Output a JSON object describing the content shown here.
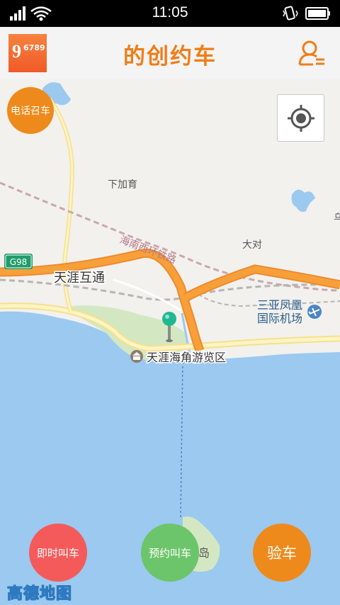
{
  "status": {
    "time": "11:05"
  },
  "header": {
    "title": "的创约车",
    "logo_main": "9",
    "logo_num": "6789"
  },
  "buttons": {
    "phone_call": "电话召车",
    "now_call": "即时叫车",
    "book_call": "预约叫车",
    "check_car": "验车"
  },
  "map": {
    "labels": {
      "xiajiayu": "下加育",
      "dadui": "大对",
      "railway": "海南西环铁路",
      "tianya_interchange": "天涯互通",
      "airport_line1": "三亚凤凰",
      "airport_line2": "国际机场",
      "scenic": "天涯海角游览区",
      "island": "岛",
      "highway": "G98",
      "edge": "乌"
    },
    "attribution": "高德地图",
    "colors": {
      "sea": "#9bc9f0",
      "land": "#f2f1ee",
      "highway": "#f7a03a",
      "green": "#d3e8c2"
    }
  }
}
